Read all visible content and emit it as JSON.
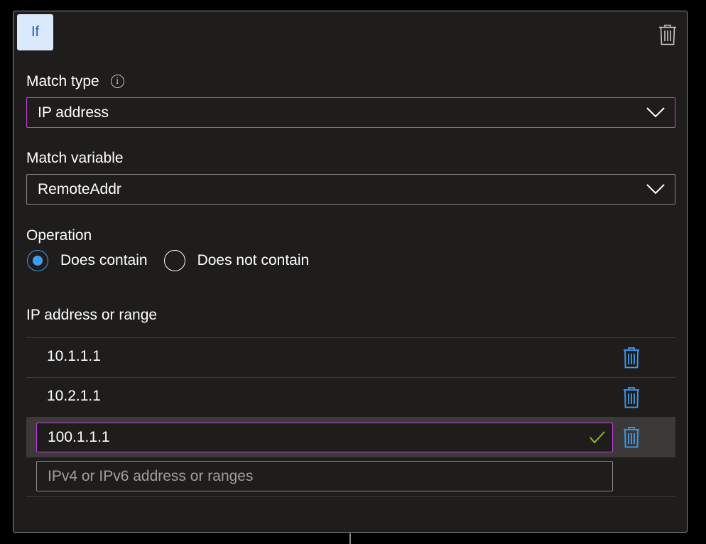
{
  "condition": {
    "badge": "If",
    "match_type": {
      "label": "Match type",
      "value": "IP address"
    },
    "match_variable": {
      "label": "Match variable",
      "value": "RemoteAddr"
    },
    "operation": {
      "label": "Operation",
      "options": [
        {
          "label": "Does contain",
          "checked": true
        },
        {
          "label": "Does not contain",
          "checked": false
        }
      ]
    },
    "ip_section": {
      "label": "IP address or range",
      "rows": [
        {
          "value": "10.1.1.1"
        },
        {
          "value": "10.2.1.1"
        }
      ],
      "editing_value": "100.1.1.1",
      "new_placeholder": "IPv4 or IPv6 address or ranges"
    }
  },
  "colors": {
    "accent": "#3b9ef5",
    "focus_border": "#c43fe0",
    "valid_check": "#8cbf26",
    "badge_bg": "#dce8fc",
    "badge_text": "#1d5fb8"
  },
  "icons": {
    "card_delete": "trash-icon",
    "row_delete": "trash-icon",
    "info": "info-icon",
    "dropdown": "chevron-down-icon",
    "valid": "checkmark-icon"
  }
}
